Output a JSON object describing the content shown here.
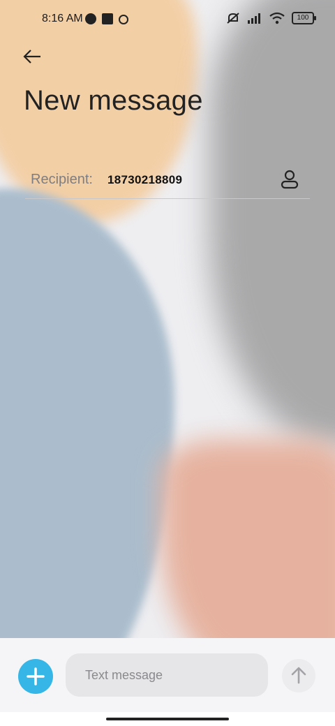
{
  "status_bar": {
    "time": "8:16 AM",
    "battery_level": "100",
    "icons": [
      "app-circle-icon",
      "app-square-icon",
      "location-pin-icon",
      "silent-icon",
      "signal-icon",
      "wifi-icon",
      "battery-icon"
    ]
  },
  "header": {
    "title": "New message"
  },
  "recipient": {
    "label": "Recipient:",
    "value": "18730218809"
  },
  "composer": {
    "placeholder": "Text message",
    "accent_color": "#35b6e7"
  }
}
